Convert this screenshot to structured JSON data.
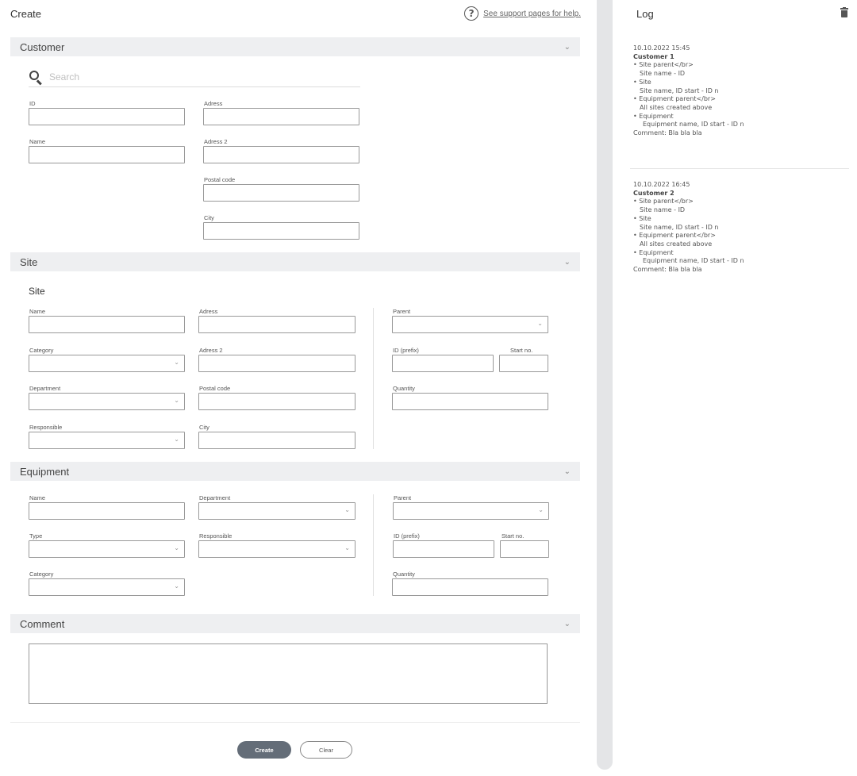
{
  "header": {
    "title": "Create",
    "help_link": "See support pages for help."
  },
  "customer": {
    "title": "Customer",
    "search_placeholder": "Search",
    "fields": {
      "id": "ID",
      "address": "Adress",
      "name": "Name",
      "address2": "Adress 2",
      "postal_code": "Postal code",
      "city": "City"
    }
  },
  "site": {
    "title": "Site",
    "subtitle": "Site",
    "fields": {
      "name": "Name",
      "address": "Adress",
      "parent": "Parent",
      "category": "Category",
      "address2": "Adress 2",
      "id_prefix": "ID (prefix)",
      "start_no": "Start no.",
      "department": "Department",
      "postal_code": "Postal code",
      "quantity": "Quantity",
      "responsible": "Responsible",
      "city": "City"
    }
  },
  "equipment": {
    "title": "Equipment",
    "fields": {
      "name": "Name",
      "department": "Department",
      "parent": "Parent",
      "type": "Type",
      "responsible": "Responsible",
      "id_prefix": "ID (prefix)",
      "start_no": "Start no.",
      "category": "Category",
      "quantity": "Quantity"
    }
  },
  "comment": {
    "title": "Comment"
  },
  "buttons": {
    "create": "Create",
    "clear": "Clear"
  },
  "log": {
    "title": "Log",
    "entries": [
      {
        "timestamp": "10.10.2022 15:45",
        "customer": "Customer 1",
        "l1": "• Site parent</br>",
        "l2": "Site name -  ID",
        "l3": "• Site",
        "l4": "Site name, ID start - ID n",
        "l5": "• Equipment parent</br>",
        "l6": "All sites created above",
        "l7": "• Equipment",
        "l8": "Equipment name, ID start - ID n",
        "comment": "Comment: Bla bla bla"
      },
      {
        "timestamp": "10.10.2022 16:45",
        "customer": "Customer 2",
        "l1": "• Site parent</br>",
        "l2": "Site name -  ID",
        "l3": "• Site",
        "l4": "Site name, ID start - ID n",
        "l5": "• Equipment parent</br>",
        "l6": "All sites created above",
        "l7": "• Equipment",
        "l8": "Equipment name, ID start - ID n",
        "comment": "Comment: Bla bla bla"
      }
    ]
  },
  "icons": {
    "chevron": "chevron-down-icon",
    "help": "question-circle-icon",
    "search": "search-icon",
    "trash": "trash-icon"
  }
}
